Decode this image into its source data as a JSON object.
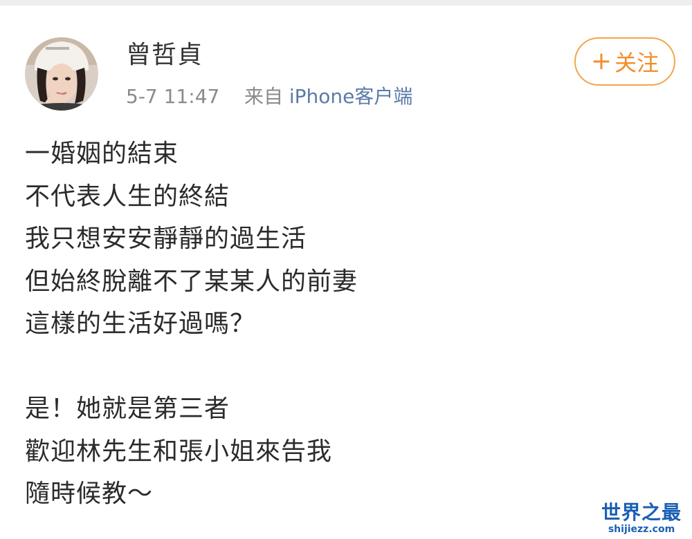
{
  "post": {
    "author": {
      "name": "曾哲貞",
      "avatar_icon": "user-avatar-photo"
    },
    "meta": {
      "time": "5-7 11:47",
      "source_prefix": "来自",
      "source": "iPhone客户端"
    },
    "follow_button": {
      "icon": "plus-icon",
      "plus": "+",
      "label": "关注"
    },
    "lines": [
      "一婚姻的結束",
      "不代表人生的終結",
      "我只想安安靜靜的過生活",
      "但始終脫離不了某某人的前妻",
      "這樣的生活好過嗎？",
      "",
      "是！她就是第三者",
      "歡迎林先生和張小姐來告我",
      "隨時候教～"
    ]
  },
  "watermark": {
    "title": "世界之最",
    "url": "shijiezz.com"
  },
  "colors": {
    "follow_accent": "#f28d2b",
    "source_link": "#5b7aa8",
    "watermark": "#1a5fb4"
  }
}
